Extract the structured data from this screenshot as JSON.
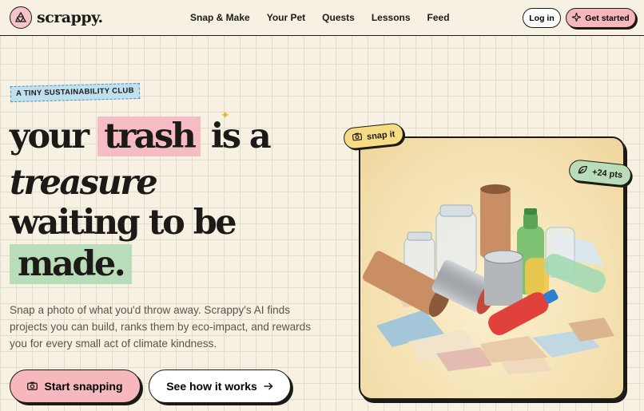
{
  "nav": {
    "logo_text": "scrappy.",
    "links": [
      "Snap & Make",
      "Your Pet",
      "Quests",
      "Lessons",
      "Feed"
    ],
    "login_label": "Log in",
    "get_started_label": "Get started"
  },
  "hero": {
    "tag": "A TINY SUSTAINABILITY CLUB",
    "headline": {
      "word_your": "your",
      "word_trash": "trash",
      "word_is_a": "is a",
      "line_treasure": "treasure",
      "line_waiting": "waiting to be",
      "word_made": "made."
    },
    "subtext": "Snap a photo of what you'd throw away. Scrappy's AI finds projects you can build, ranks them by eco-impact, and rewards you for every small act of climate kindness.",
    "primary_cta": "Start snapping",
    "secondary_cta": "See how it works"
  },
  "card": {
    "snap_chip": "snap it",
    "points_chip": "+24 pts"
  },
  "colors": {
    "background": "#f7f1e3",
    "pink_accent": "#f6b7bd",
    "green_accent": "#b9dcb9",
    "yellow_accent": "#f6dc84",
    "blue_tag": "#bfe0ee",
    "ink": "#1c1a17"
  },
  "icons": {
    "logo": "recycle-icon",
    "get_started": "sparkle-icon",
    "camera": "camera-icon",
    "arrow": "arrow-right-icon",
    "points": "leaf-icon"
  }
}
